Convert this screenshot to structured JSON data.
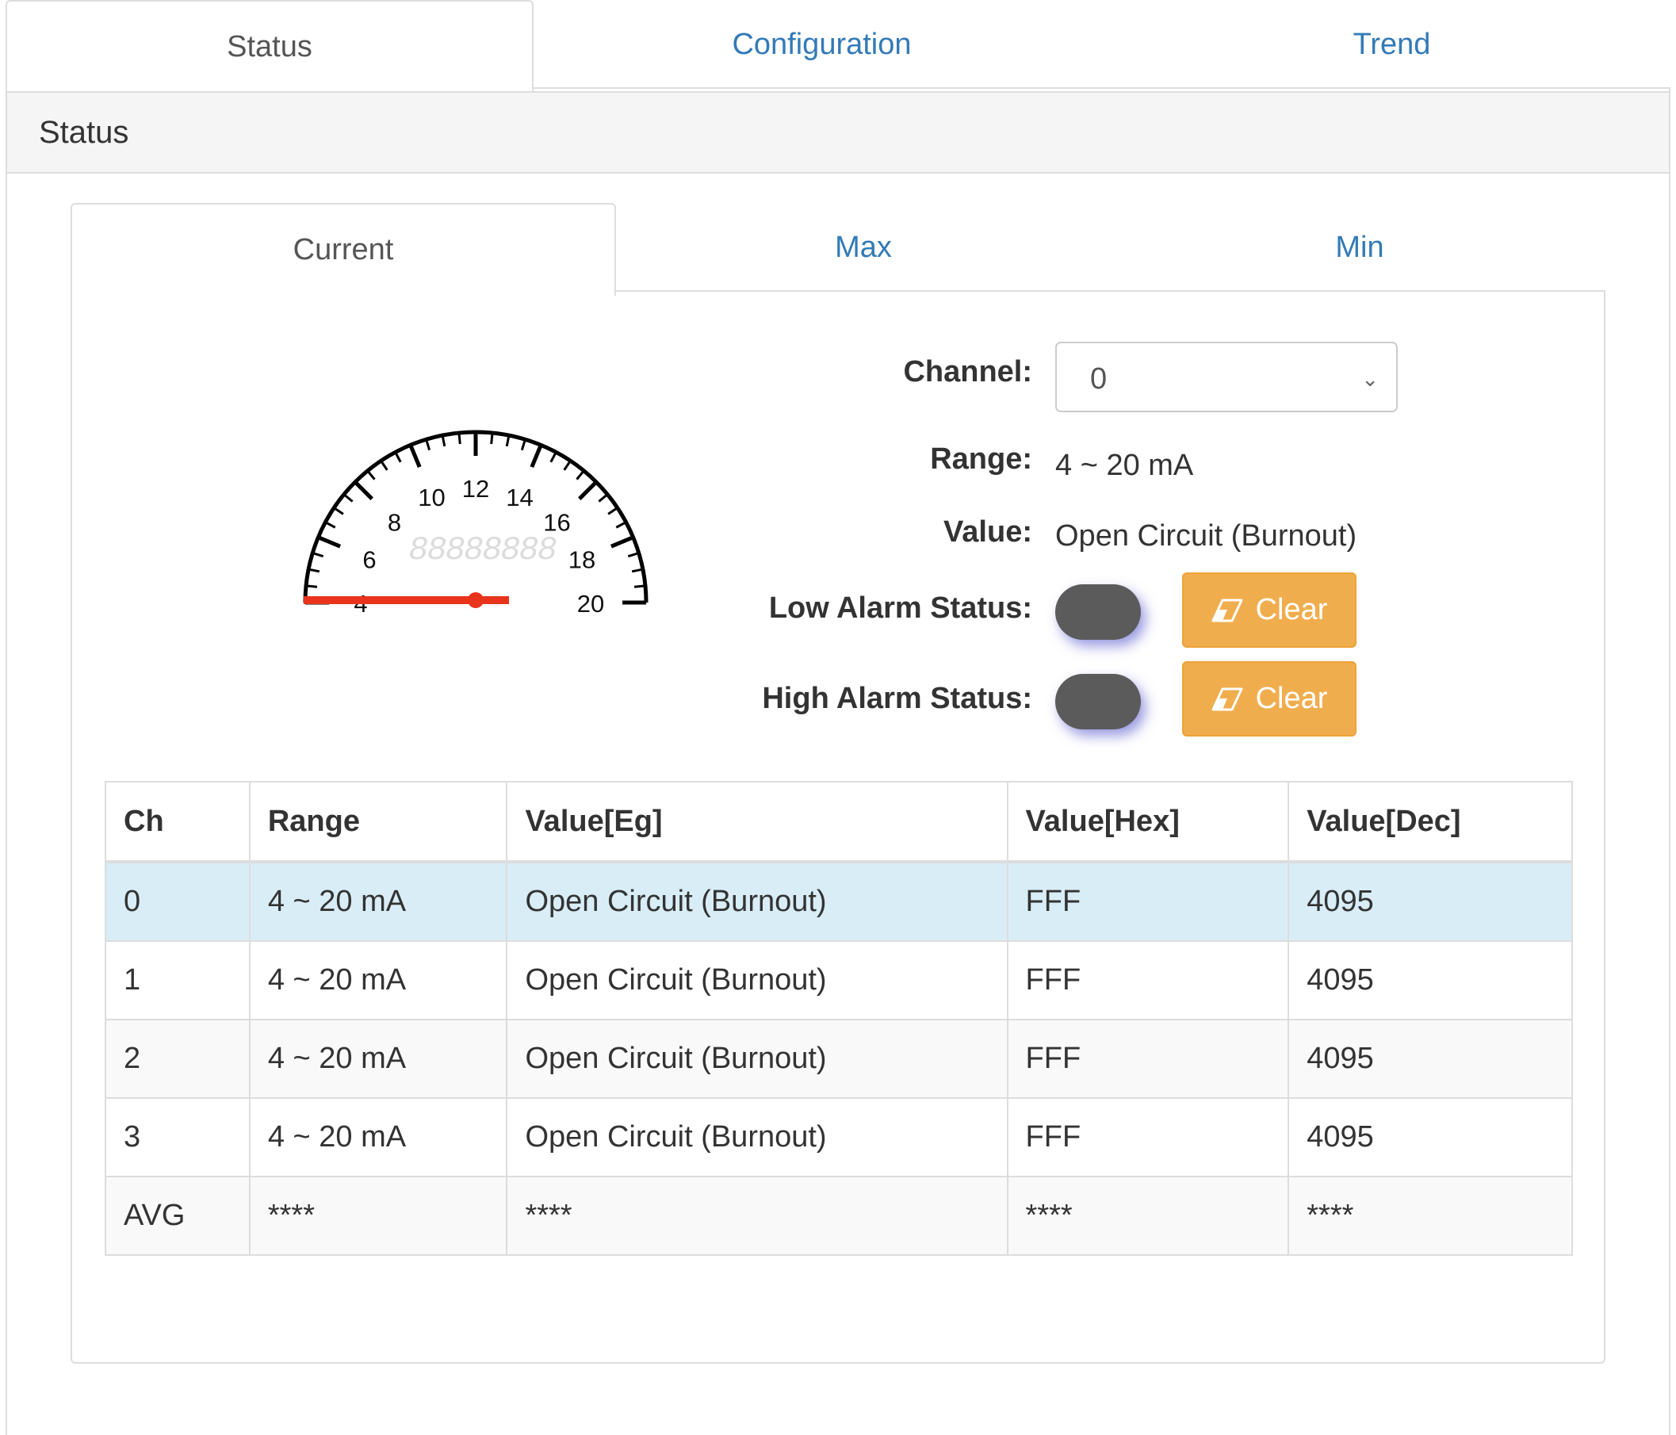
{
  "top_tabs": [
    {
      "label": "Status",
      "active": true
    },
    {
      "label": "Configuration",
      "active": false
    },
    {
      "label": "Trend",
      "active": false
    }
  ],
  "panel": {
    "title": "Status"
  },
  "sub_tabs": [
    {
      "label": "Current",
      "active": true
    },
    {
      "label": "Max",
      "active": false
    },
    {
      "label": "Min",
      "active": false
    }
  ],
  "gauge": {
    "scale_min": 4,
    "scale_max": 20,
    "ticks": [
      "4",
      "6",
      "8",
      "10",
      "12",
      "14",
      "16",
      "18",
      "20"
    ],
    "needle_value": 4,
    "display_placeholder": "88888888",
    "needle_color": "#e8341c"
  },
  "form": {
    "channel_label": "Channel:",
    "channel_value": "0",
    "range_label": "Range:",
    "range_value": "4 ~ 20 mA",
    "value_label": "Value:",
    "value_value": "Open Circuit (Burnout)",
    "low_alarm_label": "Low Alarm Status:",
    "high_alarm_label": "High Alarm Status:",
    "clear_label": "Clear",
    "clear_icon": "eraser-icon"
  },
  "table": {
    "headers": [
      "Ch",
      "Range",
      "Value[Eg]",
      "Value[Hex]",
      "Value[Dec]"
    ],
    "rows": [
      [
        "0",
        "4 ~ 20 mA",
        "Open Circuit (Burnout)",
        "FFF",
        "4095"
      ],
      [
        "1",
        "4 ~ 20 mA",
        "Open Circuit (Burnout)",
        "FFF",
        "4095"
      ],
      [
        "2",
        "4 ~ 20 mA",
        "Open Circuit (Burnout)",
        "FFF",
        "4095"
      ],
      [
        "3",
        "4 ~ 20 mA",
        "Open Circuit (Burnout)",
        "FFF",
        "4095"
      ],
      [
        "AVG",
        "****",
        "****",
        "****",
        "****"
      ]
    ]
  },
  "colors": {
    "link": "#337ab7",
    "warning": "#f0ad4e",
    "selected_row": "#d9edf7"
  }
}
